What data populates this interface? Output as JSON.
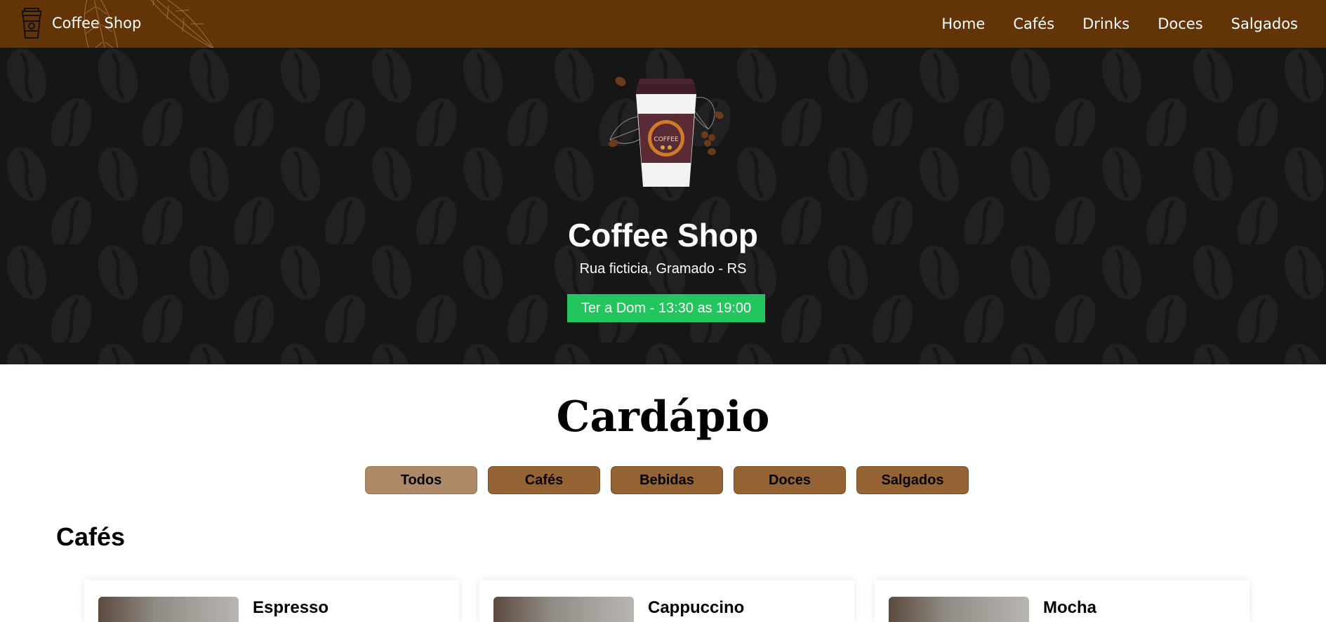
{
  "navbar": {
    "brand_name": "Coffee Shop",
    "brand_icon": "coffee-cup-icon",
    "links": [
      {
        "label": "Home"
      },
      {
        "label": "Cafés"
      },
      {
        "label": "Drinks"
      },
      {
        "label": "Doces"
      },
      {
        "label": "Salgados"
      }
    ],
    "background": "#633407"
  },
  "hero": {
    "title": "Coffee Shop",
    "address": "Rua ficticia, Gramado - RS",
    "hours": "Ter a Dom - 13:30 as 19:00",
    "hours_color": "#22c55e",
    "image": "coffee-cup-illustration",
    "cup_label": "COFFEE"
  },
  "menu": {
    "title": "Cardápio",
    "filters": [
      {
        "label": "Todos",
        "active": true
      },
      {
        "label": "Cafés",
        "active": false
      },
      {
        "label": "Bebidas",
        "active": false
      },
      {
        "label": "Doces",
        "active": false
      },
      {
        "label": "Salgados",
        "active": false
      }
    ],
    "section_title": "Cafés",
    "items": [
      {
        "name": "Espresso"
      },
      {
        "name": "Cappuccino"
      },
      {
        "name": "Mocha"
      }
    ]
  }
}
